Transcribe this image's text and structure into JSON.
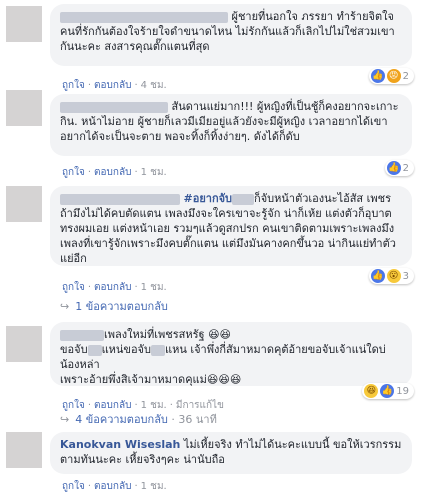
{
  "comments": [
    {
      "text_after_name": "ผู้ชายที่นอกใจ ภรรยา ทำร้ายจิตใจคนที่รักกันต้องใจร้ายใจดำขนาดไหน ไม่รักกันแล้วก็เลิกไปไม่ใช่สวมเขากันนะคะ สงสารคุณตั๊กแตนที่สุด",
      "like": "ถูกใจ",
      "reply": "ตอบกลับ",
      "time": "4 ชม.",
      "reaction_count": "2"
    },
    {
      "text_after_name": "สันดานแย่มาก!!! ผู้หญิงที่เป็นชู้ก็คงอยากจะเกาะกิน. หน้าไม่อาย ผู้ชายก็เลวมีเมียอยู่แล้วยังจะมีผู้หญิง เวลาอยากได้เขาอยากได้จะเป็นจะตาย พอจะทิ้งก็ทิ้งง่ายๆ. ดังได้ก็ดับ",
      "like": "ถูกใจ",
      "reply": "ตอบกลับ",
      "time": "1 ชม.",
      "reaction_count": "2"
    },
    {
      "hashtag": "#อยากจับ",
      "text_after_name": "ก็จับหน้าตัวเองนะไอ้สัส เพชร ถ้ามึงไม่ได้คบตัดแตน เพลงมึงจะใครเขาจะรู้จัก น่าก็เห้ย แต่งตัวก็อุบาต ทรงผมเอย แต่งหน้าเอย รวมๆแล้วดูสกปรก คนเขาติดตามเพราะเพลงมึง เพลงที่เขารู้จักเพราะมึงคบตั๊กแตน แต่มึงมันคางคกขึ้นวอ น่ากินแย่ทำตัวแย่อีก",
      "like": "ถูกใจ",
      "reply": "ตอบกลับ",
      "time": "1 ชม.",
      "reaction_count": "3",
      "replies_text": "1 ข้อความตอบกลับ"
    },
    {
      "line1": "เพลงใหม่ที่เพชรสหรัฐ",
      "line2a": "ขอจับ",
      "line2b": "แหน่ขอจับ",
      "line2c": "แหน เจ้าพึ่งกี่สัมาหมาดคุต้อ้ายขอจับเจ้าแน่ใดบ่น้องหล่า",
      "line3": "เพราะอ้ายพึ่งสิเจ้ามาหมาดคุแม่",
      "like": "ถูกใจ",
      "reply": "ตอบกลับ",
      "time": "1 ชม.",
      "edited": "มีการแก้ไข",
      "reaction_count": "19",
      "replies_text": "4 ข้อความตอบกลับ",
      "replies_time": "36 นาที"
    },
    {
      "name": "Kanokvan Wiseslah",
      "text": "ไม่เหี้ยจริง ทำไม่ได้นะคะแบบนี้ ขอให้เวรกรรมตามทันนะคะ เหี้ยจริงๆคะ น่านับถือ",
      "like": "ถูกใจ",
      "reply": "ตอบกลับ",
      "time": "1 ชม."
    }
  ],
  "emoji": {
    "laugh": "😆",
    "wow": "😮",
    "angry": "😡",
    "like": "👍"
  }
}
